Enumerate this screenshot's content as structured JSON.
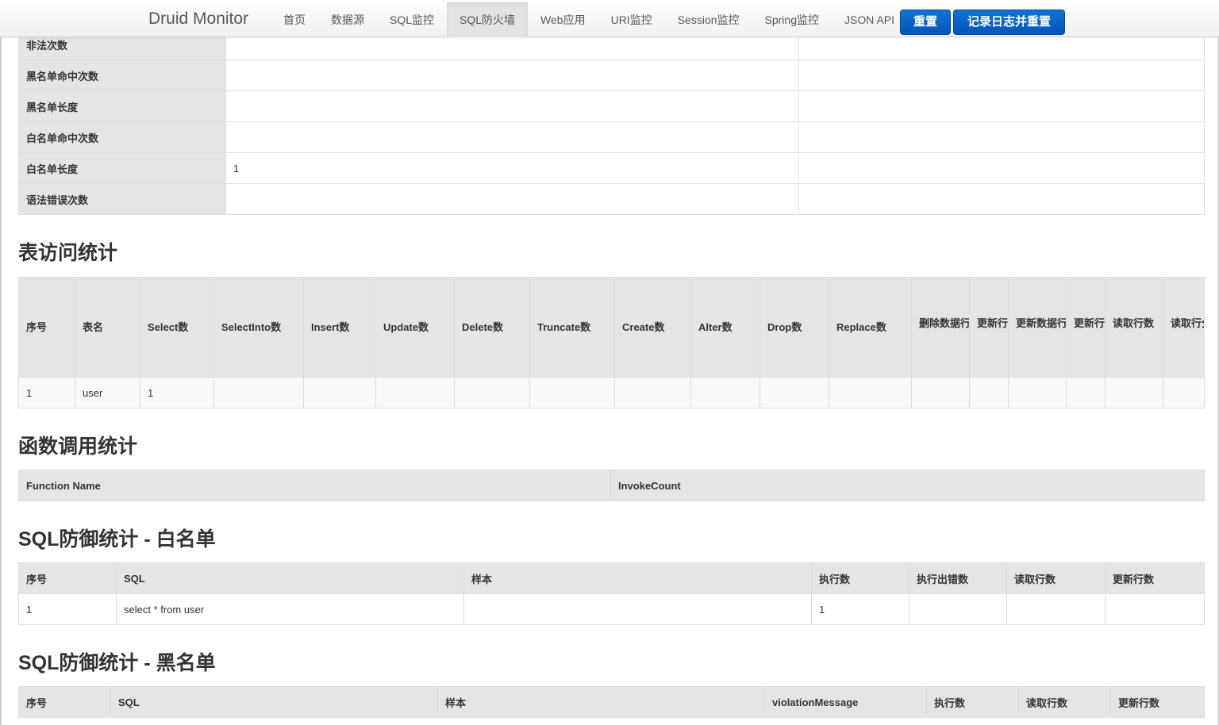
{
  "navbar": {
    "brand": "Druid Monitor",
    "items": [
      "首页",
      "数据源",
      "SQL监控",
      "SQL防火墙",
      "Web应用",
      "URI监控",
      "Session监控",
      "Spring监控",
      "JSON API"
    ],
    "active_item": "SQL防火墙",
    "reset_label": "重置",
    "log_reset_label": "记录日志并重置",
    "button_color": "#0a64c9"
  },
  "firewall_stats": {
    "rows": [
      {
        "label": "非法次数",
        "value": "",
        "extra": ""
      },
      {
        "label": "黑名单命中次数",
        "value": "",
        "extra": ""
      },
      {
        "label": "黑名单长度",
        "value": "",
        "extra": ""
      },
      {
        "label": "白名单命中次数",
        "value": "",
        "extra": ""
      },
      {
        "label": "白名单长度",
        "value": "1",
        "extra": ""
      },
      {
        "label": "语法错误次数",
        "value": "",
        "extra": ""
      }
    ]
  },
  "table_stats": {
    "title": "表访问统计",
    "columns": [
      "序号",
      "表名",
      "Select数",
      "SelectInto数",
      "Insert数",
      "Update数",
      "Delete数",
      "Truncate数",
      "Create数",
      "Alter数",
      "Drop数",
      "Replace数",
      "删除数据行数",
      "更新行分布[ - - - - - - ]",
      "更新数据行数",
      "更新行分布[ - - - - - - ]",
      "读取行数",
      "读取行分布[ - - - - - - ]"
    ],
    "rows": [
      [
        "1",
        "user",
        "1",
        "",
        "",
        "",
        "",
        "",
        "",
        "",
        "",
        "",
        "",
        "",
        "",
        "",
        "",
        ""
      ]
    ]
  },
  "function_stats": {
    "title": "函数调用统计",
    "columns": [
      "Function Name",
      "InvokeCount"
    ],
    "rows": []
  },
  "whitelist": {
    "title": "SQL防御统计 - 白名单",
    "columns": [
      "序号",
      "SQL",
      "样本",
      "执行数",
      "执行出错数",
      "读取行数",
      "更新行数"
    ],
    "rows": [
      [
        "1",
        "select * from user",
        "",
        "1",
        "",
        "",
        ""
      ]
    ]
  },
  "blacklist": {
    "title": "SQL防御统计 - 黑名单",
    "columns": [
      "序号",
      "SQL",
      "样本",
      "violationMessage",
      "执行数",
      "读取行数",
      "更新行数"
    ],
    "rows": []
  }
}
